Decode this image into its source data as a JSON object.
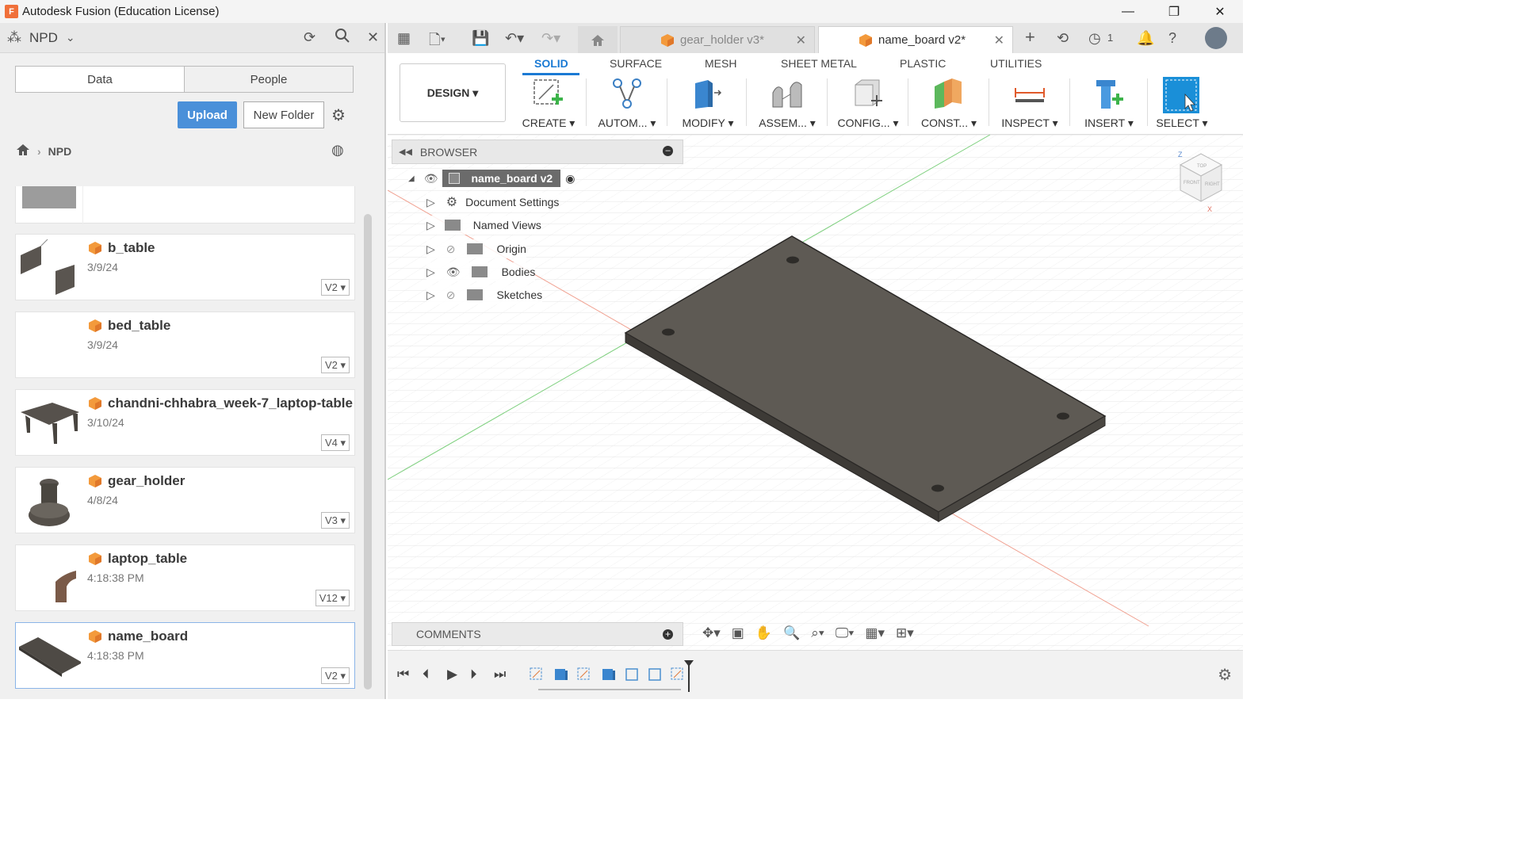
{
  "window": {
    "title": "Autodesk Fusion (Education License)",
    "app_icon": "F",
    "controls": [
      "minimize-icon",
      "restore-icon",
      "close-icon"
    ]
  },
  "left_panel": {
    "project": "NPD",
    "segments": {
      "data": "Data",
      "people": "People"
    },
    "upload_label": "Upload",
    "new_folder_label": "New Folder",
    "breadcrumb": "NPD",
    "files": [
      {
        "name": "",
        "date": "",
        "version": ""
      },
      {
        "name": "b_table",
        "date": "3/9/24",
        "version": "V2"
      },
      {
        "name": "bed_table",
        "date": "3/9/24",
        "version": "V2"
      },
      {
        "name": "chandni-chhabra_week-7_laptop-table",
        "date": "3/10/24",
        "version": "V4"
      },
      {
        "name": "gear_holder",
        "date": "4/8/24",
        "version": "V3"
      },
      {
        "name": "laptop_table",
        "date": "4:18:38 PM",
        "version": "V12"
      },
      {
        "name": "name_board",
        "date": "4:18:38 PM",
        "version": "V2"
      }
    ]
  },
  "tabs": {
    "inactive": "gear_holder v3*",
    "active": "name_board v2*",
    "job_count": "1"
  },
  "toolbar": {
    "design": "DESIGN",
    "tabs": [
      "SOLID",
      "SURFACE",
      "MESH",
      "SHEET METAL",
      "PLASTIC",
      "UTILITIES"
    ],
    "tools": [
      "CREATE",
      "AUTOM...",
      "MODIFY",
      "ASSEM...",
      "CONFIG...",
      "CONST...",
      "INSPECT",
      "INSERT",
      "SELECT"
    ]
  },
  "browser": {
    "title": "BROWSER",
    "root": "name_board v2",
    "items": [
      "Document Settings",
      "Named Views",
      "Origin",
      "Bodies",
      "Sketches"
    ]
  },
  "viewcube": {
    "top": "TOP",
    "front": "FRONT",
    "right": "RIGHT",
    "z": "Z",
    "x": "X"
  },
  "comments": "COMMENTS",
  "colors": {
    "accent": "#1a7ad4",
    "upload": "#4a90d9",
    "plate": "#5e5a54",
    "fusion_orange": "#f0703a"
  }
}
